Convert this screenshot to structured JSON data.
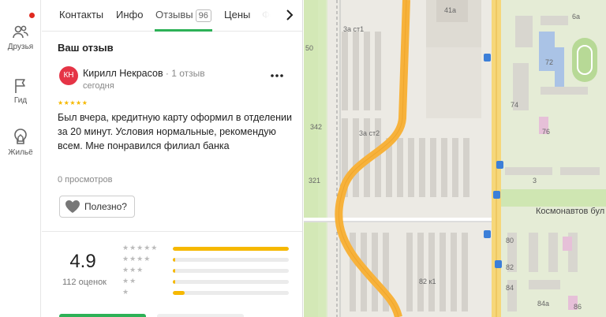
{
  "rail": {
    "items": [
      {
        "label": "Друзья",
        "icon": "friends-icon"
      },
      {
        "label": "Гид",
        "icon": "flag-icon"
      },
      {
        "label": "Жильё",
        "icon": "house-icon"
      }
    ]
  },
  "tabs": {
    "items": [
      {
        "label": "Контакты"
      },
      {
        "label": "Инфо"
      },
      {
        "label": "Отзывы",
        "badge": "96",
        "active": true
      },
      {
        "label": "Цены"
      },
      {
        "label": "Фо"
      }
    ]
  },
  "review": {
    "section_title": "Ваш отзыв",
    "avatar_initials": "КН",
    "author": "Кирилл Некрасов",
    "author_meta": " · 1 отзыв",
    "date": "сегодня",
    "stars": "★★★★★",
    "text": "Был вчера, кредитную карту оформил в отделении за 20 минут. Условия нормальные, рекомендую всем. Мне понравился филиал банка",
    "views": "0 просмотров",
    "useful_label": "Полезно?"
  },
  "rating": {
    "value": "4.9",
    "count": "112 оценок",
    "distribution": [
      {
        "stars": "★★★★★",
        "fraction": 1.0
      },
      {
        "stars": "★★★★",
        "fraction": 0.02
      },
      {
        "stars": "★★★",
        "fraction": 0.02
      },
      {
        "stars": "★★",
        "fraction": 0.02
      },
      {
        "stars": "★",
        "fraction": 0.1
      }
    ]
  },
  "map": {
    "labels": [
      "41а",
      "6а",
      "3а ст1",
      "50",
      "72",
      "74",
      "3а ст2",
      "342",
      "76",
      "321",
      "3",
      "80",
      "82",
      "82 к1",
      "84",
      "84а",
      "86"
    ],
    "street": "Космонавтов бул"
  },
  "colors": {
    "accent": "#2db157",
    "avatar": "#e53446",
    "star": "#f6b800",
    "road": "#f7b23b"
  }
}
